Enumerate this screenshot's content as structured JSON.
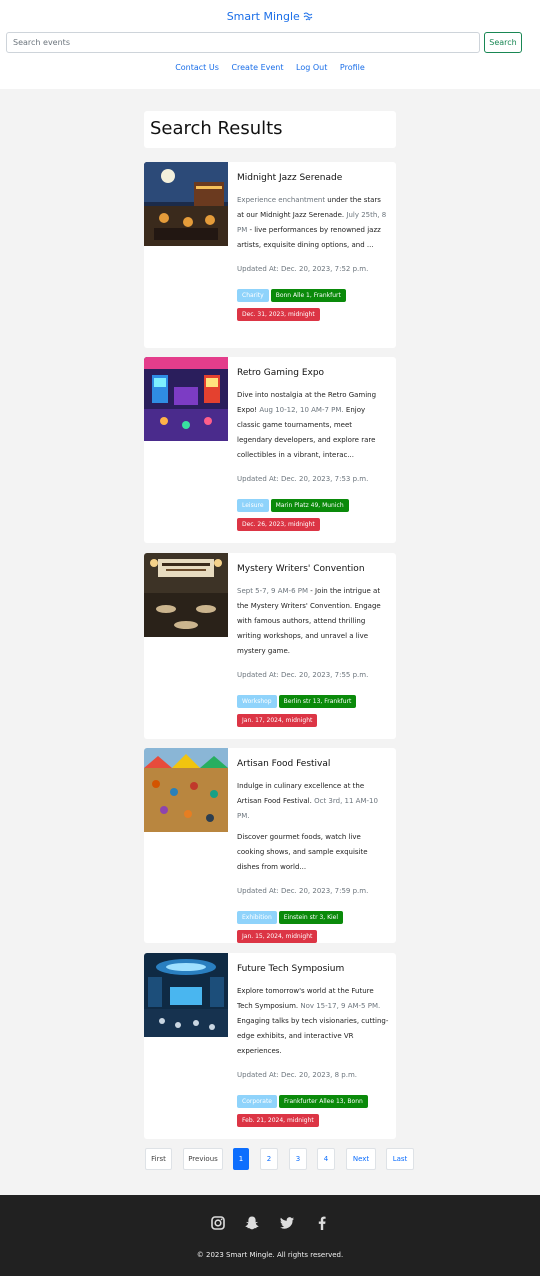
{
  "header": {
    "brand": "Smart Mingle",
    "brand_icon": "wave-icon",
    "search_placeholder": "Search events",
    "search_button": "Search",
    "nav": [
      "Contact Us",
      "Create Event",
      "Log Out",
      "Profile"
    ]
  },
  "results_title": "Search Results",
  "events": [
    {
      "title": "Midnight Jazz Serenade",
      "text_muted": "Experience enchantment",
      "text_main": " under the stars at our Midnight Jazz Serenade. ",
      "text_muted2": "July 25th, 8 PM",
      "text_end": " - live performances by renowned jazz artists, exquisite dining options, and ...",
      "updated": "Updated At: Dec. 20, 2023, 7:52 p.m.",
      "category": "Charity",
      "location": "Bonn Alle 1, Frankfurt",
      "date": "Dec. 31, 2023, midnight"
    },
    {
      "title": "Retro Gaming Expo",
      "text_main": "Dive into nostalgia at the Retro Gaming Expo! ",
      "text_muted2": "Aug 10-12, 10 AM-7 PM.",
      "text_end": " Enjoy classic game tournaments, meet legendary developers, and explore rare collectibles in a vibrant, interac...",
      "updated": "Updated At: Dec. 20, 2023, 7:53 p.m.",
      "category": "Leisure",
      "location": "Marin Platz 49, Munich",
      "date": "Dec. 26, 2023, midnight"
    },
    {
      "title": "Mystery Writers' Convention",
      "text_muted": "Sept 5-7, 9 AM-6 PM",
      "text_main": " - Join the intrigue at the Mystery Writers' Convention. Engage with famous authors, attend thrilling writing workshops, and unravel a live mystery game.",
      "updated": "Updated At: Dec. 20, 2023, 7:55 p.m.",
      "category": "Workshop",
      "location": "Berlin str 13, Frankfurt",
      "date": "Jan. 17, 2024, midnight"
    },
    {
      "title": "Artisan Food Festival",
      "text_main": "Indulge in culinary excellence at the Artisan Food Festival. ",
      "text_muted2": "Oct 3rd, 11 AM-10 PM.",
      "text_p2": "Discover gourmet foods, watch live cooking shows, and sample exquisite dishes from world...",
      "updated": "Updated At: Dec. 20, 2023, 7:59 p.m.",
      "category": "Exhibition",
      "location": "Einstein str 3, Kiel",
      "date": "Jan. 15, 2024, midnight"
    },
    {
      "title": "Future Tech Symposium",
      "text_main": "Explore tomorrow's world at the Future Tech Symposium. ",
      "text_muted2": "Nov 15-17, 9 AM-5 PM.",
      "text_end": " Engaging talks by tech visionaries, cutting-edge exhibits, and interactive VR experiences.",
      "updated": "Updated At: Dec. 20, 2023, 8 p.m.",
      "category": "Corporate",
      "location": "Frankfurter Allee 13, Bonn",
      "date": "Feb. 21, 2024, midnight"
    }
  ],
  "pagination": {
    "first": "First",
    "previous": "Previous",
    "pages": [
      "1",
      "2",
      "3",
      "4"
    ],
    "current": "1",
    "next": "Next",
    "last": "Last"
  },
  "footer": {
    "icons": [
      "instagram-icon",
      "snapchat-icon",
      "twitter-icon",
      "facebook-icon"
    ],
    "copyright": "© 2023 Smart Mingle. All rights reserved."
  },
  "colors": {
    "link": "#1a6ee8",
    "success": "#198754",
    "category_badge": "#8fd3fb",
    "location_badge": "#0a8a0a",
    "date_badge": "#dc3545",
    "footer_bg": "#212121"
  }
}
